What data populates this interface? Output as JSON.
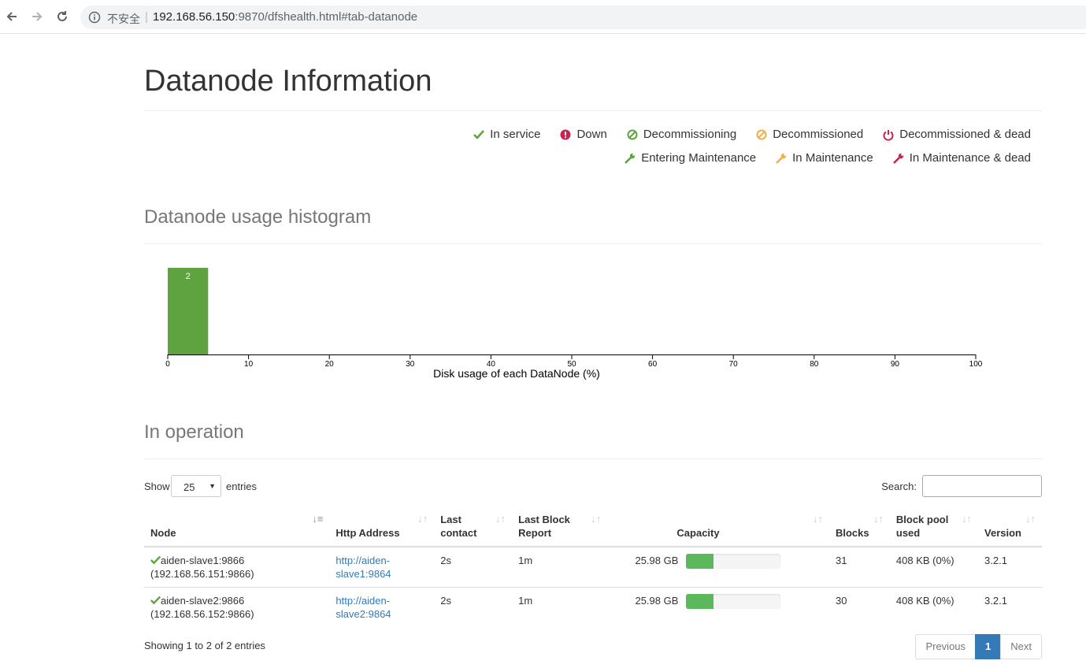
{
  "browser": {
    "insecure_label": "不安全",
    "url_host": "192.168.56.150",
    "url_rest": ":9870/dfshealth.html#tab-datanode"
  },
  "page": {
    "title": "Datanode Information"
  },
  "legend": {
    "row1": [
      {
        "icon": "check-icon",
        "label": "In service",
        "color": "#5fa341"
      },
      {
        "icon": "exclamation-circle-icon",
        "label": "Down",
        "color": "#c7254e"
      },
      {
        "icon": "ban-icon",
        "label": "Decommissioning",
        "color": "#5fa341"
      },
      {
        "icon": "ban-icon",
        "label": "Decommissioned",
        "color": "#f0ad4e"
      },
      {
        "icon": "power-icon",
        "label": "Decommissioned & dead",
        "color": "#c7254e"
      }
    ],
    "row2": [
      {
        "icon": "wrench-icon",
        "label": "Entering Maintenance",
        "color": "#5fa341"
      },
      {
        "icon": "wrench-icon",
        "label": "In Maintenance",
        "color": "#f0ad4e"
      },
      {
        "icon": "wrench-icon",
        "label": "In Maintenance & dead",
        "color": "#c7254e"
      }
    ]
  },
  "histogram": {
    "heading": "Datanode usage histogram",
    "chart_data": {
      "type": "bar",
      "bins": [
        {
          "x0": 0,
          "x1": 5,
          "count": 2
        }
      ],
      "xlabel": "Disk usage of each DataNode (%)",
      "xlim": [
        0,
        100
      ],
      "ticks": [
        "0",
        "10",
        "20",
        "30",
        "40",
        "50",
        "60",
        "70",
        "80",
        "90",
        "100"
      ],
      "bar_color": "#5fa341"
    }
  },
  "operation": {
    "heading": "In operation",
    "show_label": "Show",
    "page_length": "25",
    "entries_label": "entries",
    "search_label": "Search:",
    "columns": [
      {
        "line1": "",
        "line2": "Node"
      },
      {
        "line1": "",
        "line2": "Http Address"
      },
      {
        "line1": "Last",
        "line2": "contact"
      },
      {
        "line1": "Last Block",
        "line2": "Report"
      },
      {
        "line1": "",
        "line2": "Capacity"
      },
      {
        "line1": "",
        "line2": "Blocks"
      },
      {
        "line1": "Block pool",
        "line2": "used"
      },
      {
        "line1": "",
        "line2": "Version"
      }
    ],
    "rows": [
      {
        "node": "aiden-slave1:9866",
        "node_ip": "(192.168.56.151:9866)",
        "http1": "http://aiden-",
        "http2": "slave1:9864",
        "last_contact": "2s",
        "last_block": "1m",
        "capacity": "25.98 GB",
        "used_fraction": 0.29,
        "blocks": "31",
        "pool_used": "408 KB (0%)",
        "version": "3.2.1"
      },
      {
        "node": "aiden-slave2:9866",
        "node_ip": "(192.168.56.152:9866)",
        "http1": "http://aiden-",
        "http2": "slave2:9864",
        "last_contact": "2s",
        "last_block": "1m",
        "capacity": "25.98 GB",
        "used_fraction": 0.29,
        "blocks": "30",
        "pool_used": "408 KB (0%)",
        "version": "3.2.1"
      }
    ],
    "info": "Showing 1 to 2 of 2 entries",
    "pager": {
      "previous": "Previous",
      "current": "1",
      "next": "Next"
    }
  }
}
